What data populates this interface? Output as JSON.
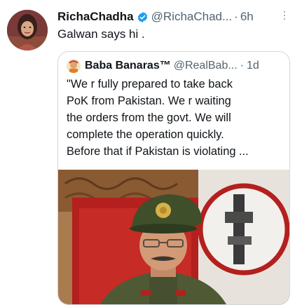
{
  "tweet": {
    "name": "RichaChadha",
    "handle": "@RichaChad...",
    "separator": "·",
    "time": "6h",
    "text": "Galwan says hi ."
  },
  "quote": {
    "name": "Baba Banaras™",
    "handle": "@RealBab...",
    "separator": "·",
    "time": "1d",
    "lines": [
      "\"We r fully prepared to take back",
      "PoK from Pakistan. We r waiting",
      "the orders from the govt. We will",
      "complete the operation quickly.",
      "Before that if Pakistan is violating ..."
    ]
  },
  "colors": {
    "verified": "#1d9bf0",
    "secondary_text": "#536471",
    "border": "#cfd9de"
  },
  "icons": {
    "verified": "verified-badge-icon",
    "more": "more-options-icon"
  }
}
